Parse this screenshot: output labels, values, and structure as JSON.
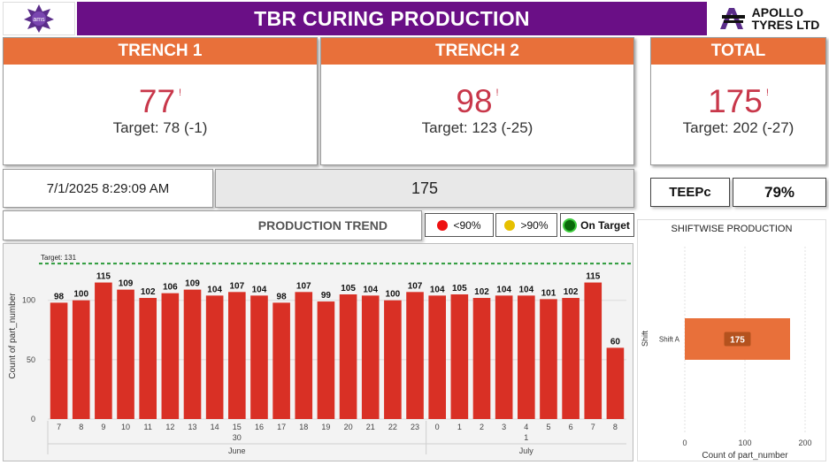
{
  "header": {
    "title": "TBR CURING PRODUCTION",
    "logo_left_text": "ams",
    "logo_right_text_line1": "APOLLO",
    "logo_right_text_line2": "TYRES LTD"
  },
  "kpis": [
    {
      "label": "TRENCH 1",
      "value": "77",
      "mark": "!",
      "target_text": "Target: 78",
      "diff": "(-1)"
    },
    {
      "label": "TRENCH 2",
      "value": "98",
      "mark": "!",
      "target_text": "Target: 123",
      "diff": "(-25)"
    },
    {
      "label": "TOTAL",
      "value": "175",
      "mark": "!",
      "target_text": "Target: 202",
      "diff": "(-27)"
    }
  ],
  "datetime": "7/1/2025 8:29:09 AM",
  "count_display": "175",
  "teepc": {
    "label": "TEEPc",
    "value": "79%"
  },
  "production_trend": {
    "title": "PRODUCTION TREND",
    "legend": [
      {
        "label": "<90%",
        "color": "#ee1111"
      },
      {
        "label": ">90%",
        "color": "#e6c000"
      },
      {
        "label": "On Target",
        "color": "#0a6a0a"
      }
    ]
  },
  "chart_data": [
    {
      "type": "bar",
      "title": "",
      "ylabel": "Count of part_number",
      "xlabel": "",
      "target_label": "Target: 131",
      "target": 131,
      "ylim": [
        0,
        140
      ],
      "yticks": [
        0,
        50,
        100
      ],
      "categories": [
        "7",
        "8",
        "9",
        "10",
        "11",
        "12",
        "13",
        "14",
        "15",
        "16",
        "17",
        "18",
        "19",
        "20",
        "21",
        "22",
        "23",
        "0",
        "1",
        "2",
        "3",
        "4",
        "5",
        "6",
        "7",
        "8"
      ],
      "values": [
        98,
        100,
        115,
        109,
        102,
        106,
        109,
        104,
        107,
        104,
        98,
        107,
        99,
        105,
        104,
        100,
        107,
        104,
        105,
        102,
        104,
        104,
        101,
        102,
        115,
        60
      ],
      "bar_color": "#d93025",
      "hierarchy": [
        {
          "day": "30",
          "month": "June",
          "from": 0,
          "to": 16
        },
        {
          "day": "1",
          "month": "July",
          "from": 17,
          "to": 25
        }
      ]
    },
    {
      "type": "bar",
      "title": "SHIFTWISE PRODUCTION",
      "orientation": "horizontal",
      "xlabel": "Count of part_number",
      "ylabel": "Shift",
      "categories": [
        "Shift A"
      ],
      "values": [
        175
      ],
      "xlim": [
        0,
        200
      ],
      "xticks": [
        0,
        100,
        200
      ],
      "bar_color": "#e8703a"
    }
  ]
}
